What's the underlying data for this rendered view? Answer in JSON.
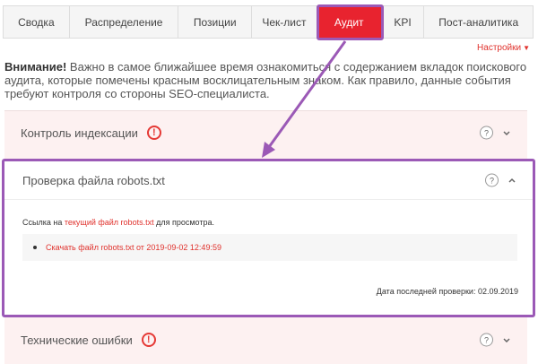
{
  "tabs": [
    {
      "label": "Сводка",
      "active": false
    },
    {
      "label": "Распределение",
      "active": false
    },
    {
      "label": "Позиции",
      "active": false
    },
    {
      "label": "Чек-лист",
      "active": false
    },
    {
      "label": "Аудит",
      "active": true
    },
    {
      "label": "KPI",
      "active": false
    },
    {
      "label": "Пост-аналитика",
      "active": false
    }
  ],
  "settings": {
    "label": "Настройки"
  },
  "notice": {
    "strong": "Внимание!",
    "text": " Важно в самое ближайшее время ознакомиться с содержанием вкладок поискового аудита, которые помечены красным восклицательным знаком. Как правило, данные события требуют контроля со стороны SEO-специалиста."
  },
  "sections": {
    "indexing": {
      "title": "Контроль индексации",
      "help": "?"
    },
    "robots": {
      "title": "Проверка файла robots.txt",
      "help": "?",
      "intro_prefix": "Ссылка на ",
      "intro_link": "текущий файл robots.txt",
      "intro_suffix": " для просмотра.",
      "download_link": "Скачать файл robots.txt от 2019-09-02 12:49:59",
      "last_check": "Дата последней проверки: 02.09.2019"
    },
    "tech": {
      "title": "Технические ошибки",
      "help": "?"
    }
  },
  "icons": {
    "alert": "!"
  },
  "colors": {
    "accent": "#e8232f",
    "highlight": "#9b59b6",
    "link": "#e0322d"
  }
}
